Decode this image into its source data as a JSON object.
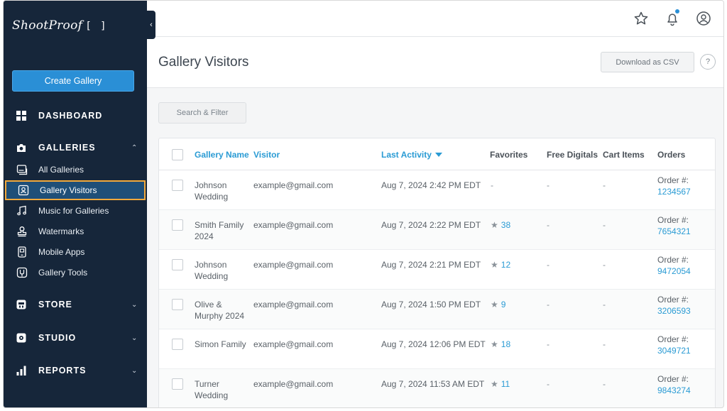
{
  "sidebar": {
    "logo_text": "ShootProof",
    "logo_brackets": "[ ]",
    "collapse_glyph": "‹",
    "create_label": "Create Gallery",
    "sections": {
      "dashboard": "DASHBOARD",
      "galleries": "GALLERIES",
      "store": "STORE",
      "studio": "STUDIO",
      "reports": "REPORTS"
    },
    "gallery_items": [
      {
        "label": "All Galleries",
        "icon": "gallery-stack-icon"
      },
      {
        "label": "Gallery Visitors",
        "icon": "visitor-card-icon",
        "active": true
      },
      {
        "label": "Music for Galleries",
        "icon": "music-note-icon"
      },
      {
        "label": "Watermarks",
        "icon": "stamp-icon"
      },
      {
        "label": "Mobile Apps",
        "icon": "mobile-phone-icon"
      },
      {
        "label": "Gallery Tools",
        "icon": "tools-icon"
      }
    ]
  },
  "header": {
    "title": "Gallery Visitors",
    "csv_label": "Download as CSV",
    "help_label": "?",
    "filter_label": "Search & Filter"
  },
  "table": {
    "columns": {
      "gallery_name": "Gallery Name",
      "visitor": "Visitor",
      "last_activity": "Last Activity",
      "favorites": "Favorites",
      "free_digitals": "Free Digitals",
      "cart_items": "Cart Items",
      "orders": "Orders"
    },
    "rows": [
      {
        "gallery": "Johnson Wedding",
        "visitor": "example@gmail.com",
        "activity": "Aug 7, 2024 2:42 PM EDT",
        "favorites": "-",
        "digitals": "-",
        "cart": "-",
        "order_label": "Order #:",
        "order_num": "1234567"
      },
      {
        "gallery": "Smith Family 2024",
        "visitor": "example@gmail.com",
        "activity": "Aug 7, 2024 2:22 PM EDT",
        "favorites": "38",
        "digitals": "-",
        "cart": "-",
        "order_label": "Order #:",
        "order_num": "7654321"
      },
      {
        "gallery": "Johnson Wedding",
        "visitor": "example@gmail.com",
        "activity": "Aug 7, 2024 2:21 PM EDT",
        "favorites": "12",
        "digitals": "-",
        "cart": "-",
        "order_label": "Order #:",
        "order_num": "9472054"
      },
      {
        "gallery": "Olive & Murphy 2024",
        "visitor": "example@gmail.com",
        "activity": "Aug 7, 2024 1:50 PM EDT",
        "favorites": "9",
        "digitals": "-",
        "cart": "-",
        "order_label": "Order #:",
        "order_num": "3206593"
      },
      {
        "gallery": "Simon Family",
        "visitor": "example@gmail.com",
        "activity": "Aug 7, 2024 12:06 PM EDT",
        "favorites": "18",
        "digitals": "-",
        "cart": "-",
        "order_label": "Order #:",
        "order_num": "3049721"
      },
      {
        "gallery": "Turner Wedding",
        "visitor": "example@gmail.com",
        "activity": "Aug 7, 2024 11:53 AM EDT",
        "favorites": "11",
        "digitals": "-",
        "cart": "-",
        "order_label": "Order #:",
        "order_num": "9843274"
      }
    ]
  },
  "colors": {
    "sidebar_bg": "#16263a",
    "accent_blue": "#2a9bd4",
    "active_outline": "#f2a93b"
  }
}
